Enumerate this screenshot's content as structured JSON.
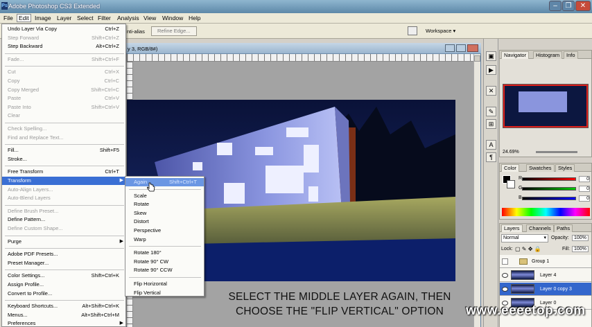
{
  "window": {
    "title": "Adobe Photoshop CS3 Extended",
    "app_icon": "Ps"
  },
  "window_controls": {
    "minimize": "–",
    "restore": "❐",
    "close": "✕"
  },
  "menubar": [
    "File",
    "Edit",
    "Image",
    "Layer",
    "Select",
    "Filter",
    "Analysis",
    "View",
    "Window",
    "Help"
  ],
  "options_bar": {
    "antialias_label": "nti-alias",
    "refine_edge": "Refine Edge...",
    "workspace": "Workspace ▾"
  },
  "document": {
    "title_fragment": "y 3, RGB/8#)"
  },
  "edit_menu": [
    {
      "label": "Undo Layer Via Copy",
      "shortcut": "Ctrl+Z",
      "disabled": false
    },
    {
      "label": "Step Forward",
      "shortcut": "Shift+Ctrl+Z",
      "disabled": true
    },
    {
      "label": "Step Backward",
      "shortcut": "Alt+Ctrl+Z",
      "disabled": false
    },
    {
      "sep": true
    },
    {
      "label": "Fade...",
      "shortcut": "Shift+Ctrl+F",
      "disabled": true
    },
    {
      "sep": true
    },
    {
      "label": "Cut",
      "shortcut": "Ctrl+X",
      "disabled": true
    },
    {
      "label": "Copy",
      "shortcut": "Ctrl+C",
      "disabled": true
    },
    {
      "label": "Copy Merged",
      "shortcut": "Shift+Ctrl+C",
      "disabled": true
    },
    {
      "label": "Paste",
      "shortcut": "Ctrl+V",
      "disabled": true
    },
    {
      "label": "Paste Into",
      "shortcut": "Shift+Ctrl+V",
      "disabled": true
    },
    {
      "label": "Clear",
      "shortcut": "",
      "disabled": true
    },
    {
      "sep": true
    },
    {
      "label": "Check Spelling...",
      "shortcut": "",
      "disabled": true
    },
    {
      "label": "Find and Replace Text...",
      "shortcut": "",
      "disabled": true
    },
    {
      "sep": true
    },
    {
      "label": "Fill...",
      "shortcut": "Shift+F5",
      "disabled": false
    },
    {
      "label": "Stroke...",
      "shortcut": "",
      "disabled": false
    },
    {
      "sep": true
    },
    {
      "label": "Free Transform",
      "shortcut": "Ctrl+T",
      "disabled": false
    },
    {
      "label": "Transform",
      "shortcut": "",
      "disabled": false,
      "submenu": true,
      "highlight": true
    },
    {
      "label": "Auto-Align Layers...",
      "shortcut": "",
      "disabled": true
    },
    {
      "label": "Auto-Blend Layers",
      "shortcut": "",
      "disabled": true
    },
    {
      "sep": true
    },
    {
      "label": "Define Brush Preset...",
      "shortcut": "",
      "disabled": true
    },
    {
      "label": "Define Pattern...",
      "shortcut": "",
      "disabled": false
    },
    {
      "label": "Define Custom Shape...",
      "shortcut": "",
      "disabled": true
    },
    {
      "sep": true
    },
    {
      "label": "Purge",
      "shortcut": "",
      "disabled": false,
      "submenu": true
    },
    {
      "sep": true
    },
    {
      "label": "Adobe PDF Presets...",
      "shortcut": "",
      "disabled": false
    },
    {
      "label": "Preset Manager...",
      "shortcut": "",
      "disabled": false
    },
    {
      "sep": true
    },
    {
      "label": "Color Settings...",
      "shortcut": "Shift+Ctrl+K",
      "disabled": false
    },
    {
      "label": "Assign Profile...",
      "shortcut": "",
      "disabled": false
    },
    {
      "label": "Convert to Profile...",
      "shortcut": "",
      "disabled": false
    },
    {
      "sep": true
    },
    {
      "label": "Keyboard Shortcuts...",
      "shortcut": "Alt+Shift+Ctrl+K",
      "disabled": false
    },
    {
      "label": "Menus...",
      "shortcut": "Alt+Shift+Ctrl+M",
      "disabled": false
    },
    {
      "label": "Preferences",
      "shortcut": "",
      "disabled": false,
      "submenu": true
    }
  ],
  "transform_submenu": [
    {
      "label": "Again",
      "shortcut": "Shift+Ctrl+T",
      "highlight": true
    },
    {
      "sep": true
    },
    {
      "label": "Scale"
    },
    {
      "label": "Rotate"
    },
    {
      "label": "Skew"
    },
    {
      "label": "Distort"
    },
    {
      "label": "Perspective"
    },
    {
      "label": "Warp"
    },
    {
      "sep": true
    },
    {
      "label": "Rotate 180°"
    },
    {
      "label": "Rotate 90° CW"
    },
    {
      "label": "Rotate 90° CCW"
    },
    {
      "sep": true
    },
    {
      "label": "Flip Horizontal"
    },
    {
      "label": "Flip Vertical"
    }
  ],
  "caption": {
    "line1": "SELECT THE MIDDLE LAYER AGAIN, THEN",
    "line2": "CHOOSE THE \"FLIP VERTICAL\" OPTION"
  },
  "watermark": "www.eeeetop.com",
  "navigator": {
    "tabs": [
      "Navigator",
      "Histogram",
      "Info"
    ],
    "zoom": "24.69%"
  },
  "color_panel": {
    "tabs": [
      "Color",
      "Swatches",
      "Styles"
    ],
    "channels": [
      {
        "label": "R",
        "value": "0"
      },
      {
        "label": "G",
        "value": "0"
      },
      {
        "label": "B",
        "value": "0"
      }
    ]
  },
  "layers_panel": {
    "tabs": [
      "Layers",
      "Channels",
      "Paths"
    ],
    "blend_mode": "Normal",
    "opacity_label": "Opacity:",
    "opacity": "100%",
    "lock_label": "Lock:",
    "fill_label": "Fill:",
    "fill": "100%",
    "layers": [
      {
        "name": "Group 1",
        "selected": false,
        "visible": false,
        "group": true
      },
      {
        "name": "Layer 4",
        "selected": false,
        "visible": true
      },
      {
        "name": "Layer 0 copy 3",
        "selected": true,
        "visible": true
      },
      {
        "name": "Layer 0",
        "selected": false,
        "visible": true
      }
    ]
  },
  "colors": {
    "accent": "#3a6fd4",
    "selected_layer": "#3366cc",
    "night_sky": "#0b1742",
    "building": "#8f9be0"
  }
}
